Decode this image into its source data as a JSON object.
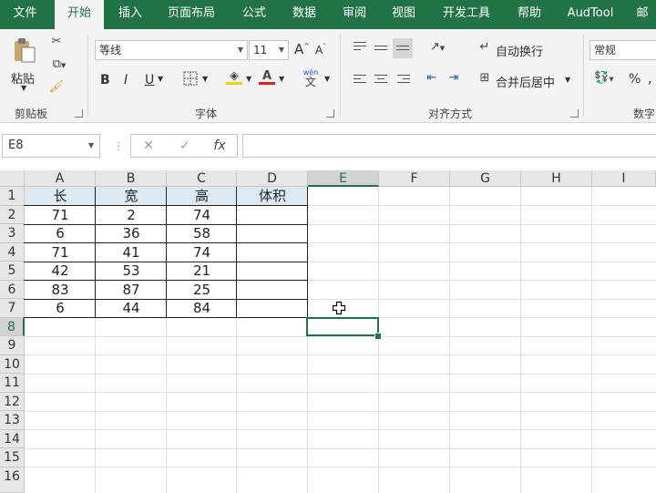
{
  "tabs": [
    "文件",
    "开始",
    "插入",
    "页面布局",
    "公式",
    "数据",
    "审阅",
    "视图",
    "开发工具",
    "帮助",
    "AudTool",
    "邮"
  ],
  "active_tab": "开始",
  "clipboard": {
    "paste_label": "粘贴",
    "group_label": "剪贴板"
  },
  "font": {
    "name": "等线",
    "size": "11",
    "grow": "A",
    "shrink": "A",
    "bold": "B",
    "italic": "I",
    "underline": "U",
    "wen": "wén",
    "wen_char": "文",
    "group_label": "字体"
  },
  "alignment": {
    "wrap_label": "自动换行",
    "merge_label": "合并后居中",
    "group_label": "对齐方式"
  },
  "number": {
    "format": "常规",
    "percent": "%",
    "group_label": "数字"
  },
  "formula_bar": {
    "name_box": "E8",
    "cancel": "✕",
    "enter": "✓",
    "fx": "fx",
    "value": ""
  },
  "columns": [
    "A",
    "B",
    "C",
    "D",
    "E",
    "F",
    "G",
    "H",
    "I"
  ],
  "rows": [
    "1",
    "2",
    "3",
    "4",
    "5",
    "6",
    "7",
    "8",
    "9",
    "10",
    "11",
    "12",
    "13",
    "14",
    "15",
    "16"
  ],
  "selected_cell": "E8",
  "table": {
    "headers": [
      "长",
      "宽",
      "高",
      "体积"
    ],
    "rows": [
      [
        "71",
        "2",
        "74",
        ""
      ],
      [
        "6",
        "36",
        "58",
        ""
      ],
      [
        "71",
        "41",
        "74",
        ""
      ],
      [
        "42",
        "53",
        "21",
        ""
      ],
      [
        "83",
        "87",
        "25",
        ""
      ],
      [
        "6",
        "44",
        "84",
        ""
      ]
    ]
  },
  "colors": {
    "accent": "#217346",
    "header_fill": "#dde8f5",
    "font_color": "#e02020"
  }
}
